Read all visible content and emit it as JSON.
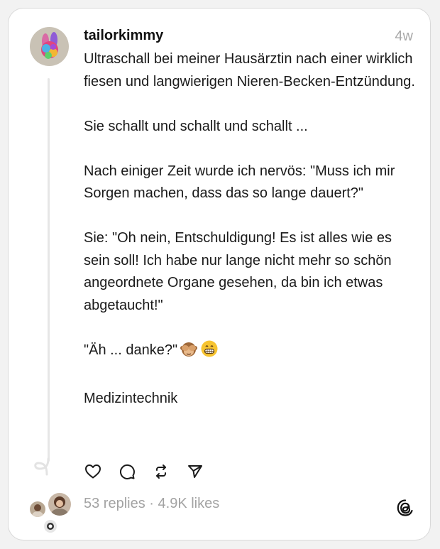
{
  "post": {
    "username": "tailorkimmy",
    "timestamp": "4w",
    "paragraphs": [
      "Ultraschall bei meiner Hausärztin nach einer wirklich fiesen und langwierigen Nieren-Becken-Entzündung.",
      "Sie schallt und schallt und schallt ...",
      "Nach einiger Zeit wurde ich nervös: \"Muss ich mir Sorgen machen, dass das so lange dauert?\"",
      "Sie: \"Oh nein, Entschuldigung! Es ist alles wie es sein soll! Ich habe nur lange nicht mehr so schön angeordnete Organe gesehen, da bin ich etwas abgetaucht!\""
    ],
    "closing_line": "\"Äh ... danke?\"",
    "closing_emojis": [
      "see-no-evil-monkey",
      "grinning-face"
    ],
    "tag": "Medizintechnik"
  },
  "actions": {
    "like_icon": "heart-icon",
    "reply_icon": "comment-icon",
    "repost_icon": "repost-icon",
    "share_icon": "send-icon"
  },
  "stats": {
    "replies": "53 replies",
    "separator": "·",
    "likes": "4.9K likes"
  },
  "colors": {
    "background": "#f2f2f2",
    "card": "#ffffff",
    "muted_text": "#a3a3a3",
    "thread_line": "#e6e6e6"
  }
}
